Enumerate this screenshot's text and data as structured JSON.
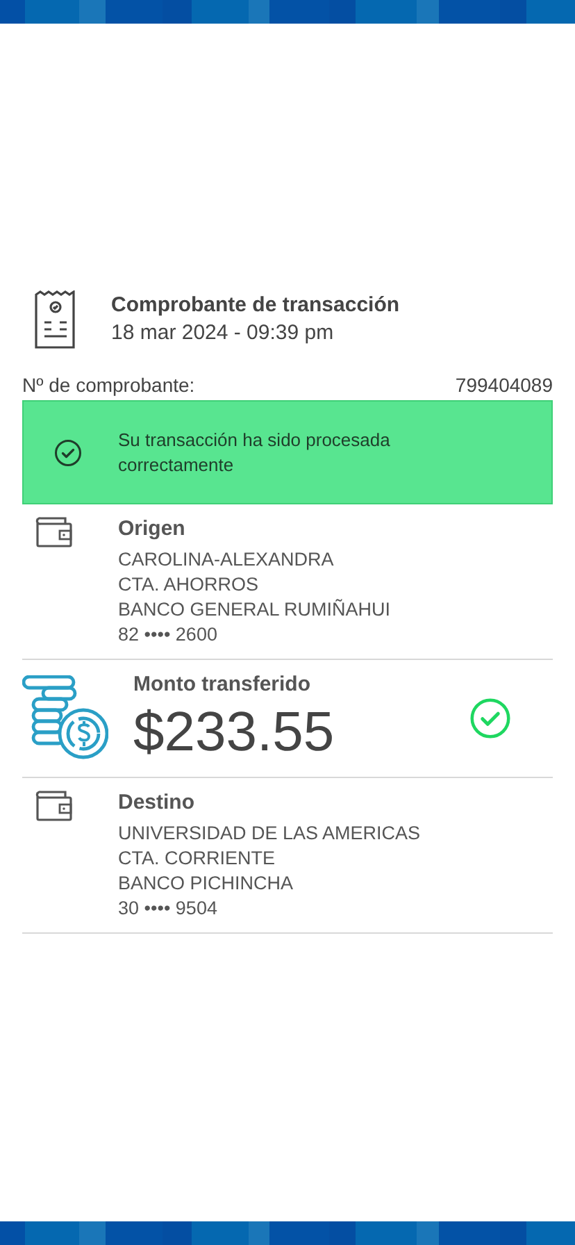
{
  "header": {
    "title": "Comprobante de transacción",
    "date": "18 mar 2024 - 09:39 pm"
  },
  "receipt_number": {
    "label": "Nº de comprobante:",
    "value": "799404089"
  },
  "status_banner": {
    "message": "Su transacción ha sido procesada correctamente"
  },
  "sections": [
    {
      "kind": "account",
      "title": "Origen",
      "lines": [
        "CAROLINA-ALEXANDRA",
        "CTA. AHORROS",
        "BANCO GENERAL RUMIÑAHUI",
        "82 •••• 2600"
      ]
    },
    {
      "kind": "amount",
      "title": "Monto transferido",
      "amount": "$233.55"
    },
    {
      "kind": "account",
      "title": "Destino",
      "lines": [
        "UNIVERSIDAD DE LAS AMERICAS",
        "CTA. CORRIENTE",
        "BANCO PICHINCHA",
        "30 •••• 9504"
      ]
    }
  ]
}
